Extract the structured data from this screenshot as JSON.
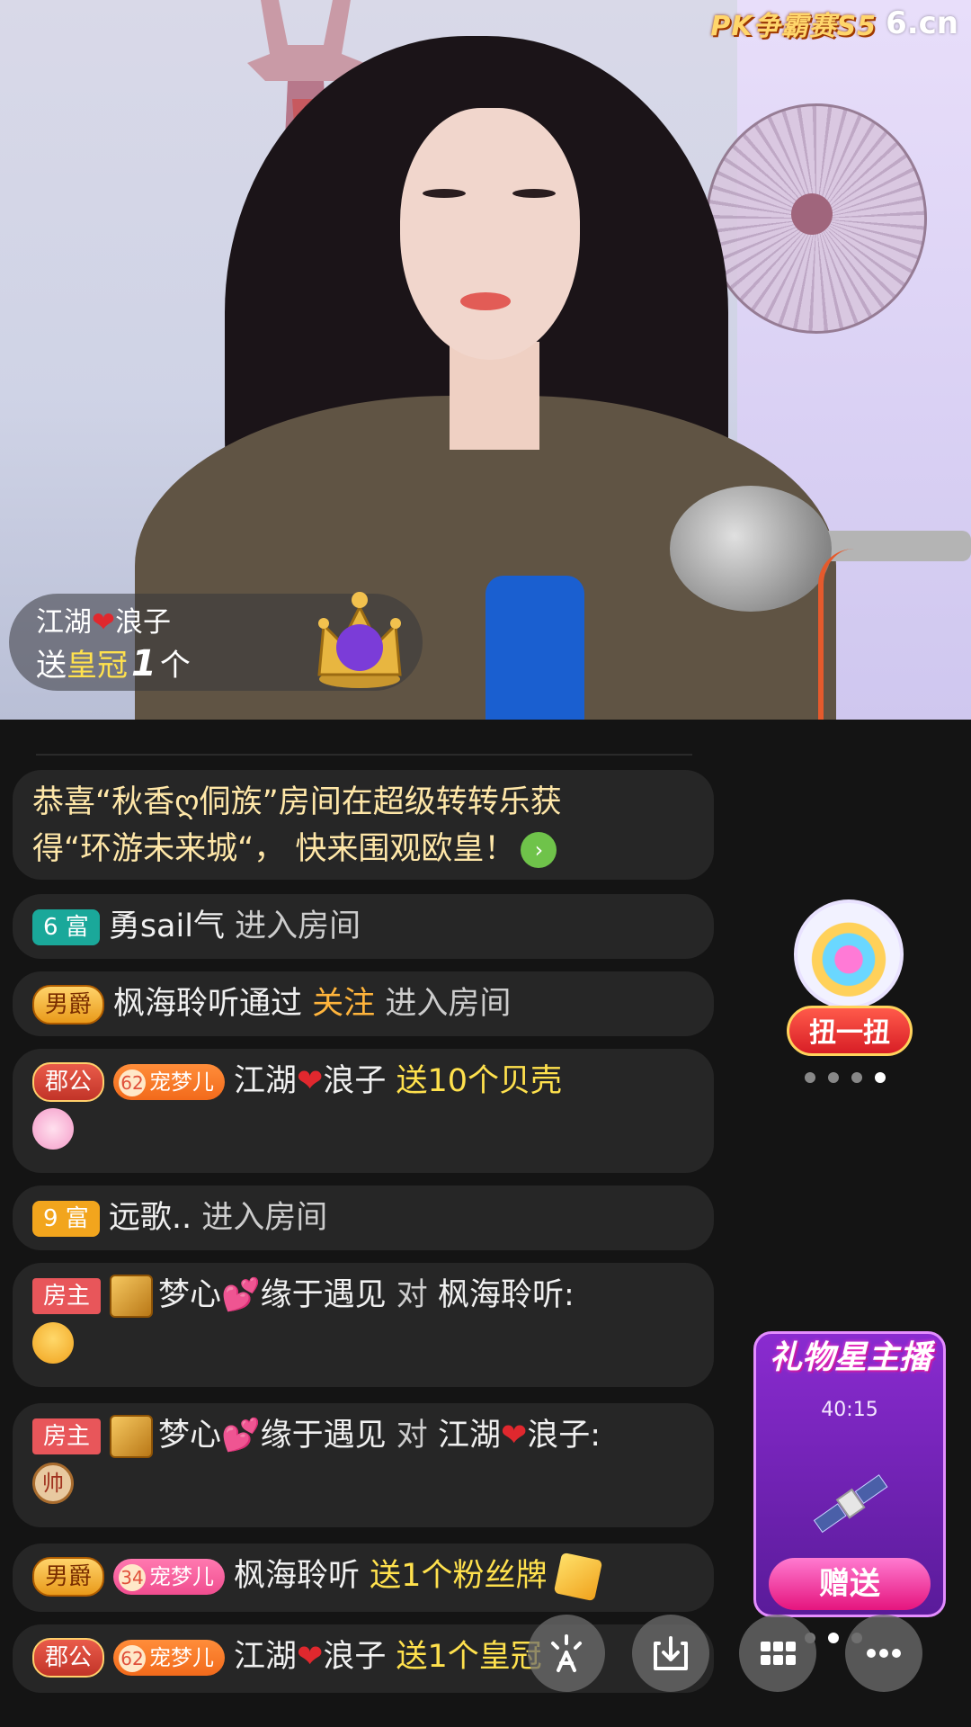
{
  "brand": {
    "pk_logo": "PK争霸赛S5",
    "site": "6.cn"
  },
  "gift_toast": {
    "user_left": "江湖",
    "user_right": "浪子",
    "prefix": "送",
    "gift_name": "皇冠",
    "count": "1",
    "unit": "个"
  },
  "announcement": {
    "line1": "恭喜“秋香ღ侗族”房间在超级转转乐获",
    "line2": "得“环游未来城“， 快来围观欧皇！"
  },
  "messages": [
    {
      "badge": "6 富",
      "name": "勇sail气",
      "action": "进入房间"
    },
    {
      "badge": "男爵",
      "name": "枫海聆听通过",
      "highlight": "关注",
      "action": "进入房间"
    },
    {
      "badge": "郡公",
      "pet_level": "62",
      "pet_name": "宠梦儿",
      "name_left": "江湖",
      "name_right": "浪子",
      "gift": "送10个贝壳"
    },
    {
      "badge": "9 富",
      "name": "远歌..",
      "action": "进入房间"
    },
    {
      "badge": "房主",
      "name_left": "梦心",
      "name_right": "缘于遇见",
      "to": "对",
      "target": "枫海聆听:"
    },
    {
      "badge": "房主",
      "name_left": "梦心",
      "name_right": "缘于遇见",
      "to": "对",
      "target_left": "江湖",
      "target_right": "浪子:",
      "sticker_text": "帅"
    },
    {
      "badge": "男爵",
      "pet_level": "34",
      "pet_name": "宠梦儿",
      "name": "枫海聆听",
      "gift": "送1个粉丝牌"
    },
    {
      "badge": "郡公",
      "pet_level": "62",
      "pet_name": "宠梦儿",
      "name_left": "江湖",
      "name_right": "浪子",
      "gift": "送1个皇冠"
    }
  ],
  "gacha": {
    "label": "扭一扭",
    "pages": 4,
    "active_page": 4
  },
  "gift_star": {
    "title": "礼物星主播",
    "timer": "40:15",
    "button": "赠送"
  },
  "toolbar": {
    "icons": [
      "lightbulb-icon",
      "download-icon",
      "grid-icon",
      "more-icon"
    ]
  },
  "colors": {
    "highlight_yellow": "#ffe14d",
    "follow_orange": "#ffb43c",
    "chat_bg": "#141414",
    "bubble_bg": "#262626"
  }
}
